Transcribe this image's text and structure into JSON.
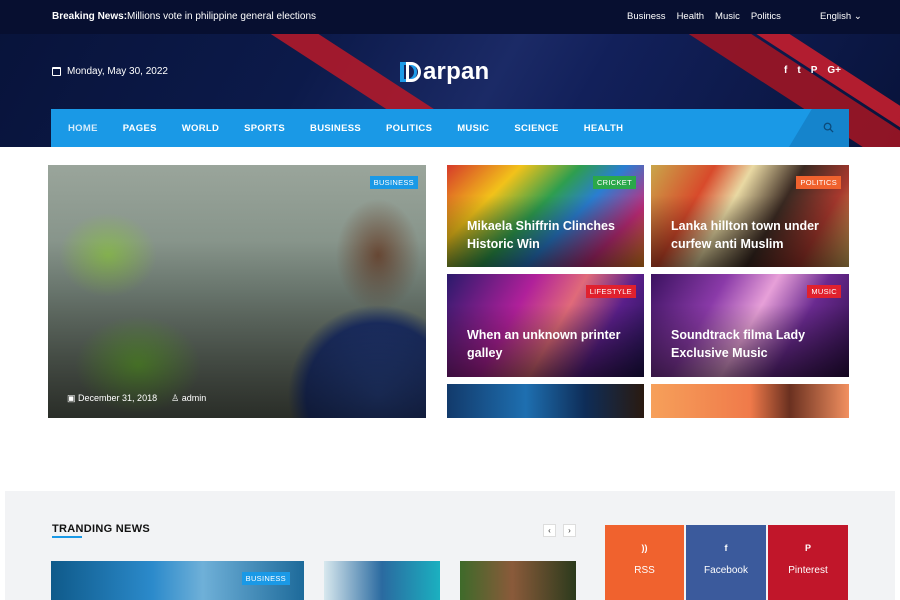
{
  "topbar": {
    "breaking_label": "Breaking News:",
    "breaking_text": "Millions vote in philippine general elections",
    "links": [
      "Business",
      "Health",
      "Music",
      "Politics"
    ],
    "language": "English"
  },
  "header": {
    "date": "Monday, May 30, 2022",
    "logo_text": "arpan",
    "socials": [
      "f",
      "t",
      "P",
      "G+"
    ]
  },
  "nav": {
    "items": [
      "HOME",
      "PAGES",
      "WORLD",
      "SPORTS",
      "BUSINESS",
      "POLITICS",
      "MUSIC",
      "SCIENCE",
      "HEALTH"
    ]
  },
  "featured": {
    "main": {
      "badge": "BUSINESS",
      "date": "December 31, 2018",
      "author": "admin"
    },
    "cards": [
      {
        "badge": "CRICKET",
        "title": "Mikaela Shiffrin Clinches Historic Win",
        "badge_color": "#2aa84a"
      },
      {
        "badge": "POLITICS",
        "title": "Lanka hillton town under curfew anti Muslim",
        "badge_color": "#f0622e"
      },
      {
        "badge": "LIFESTYLE",
        "title": "When an unknown printer galley",
        "badge_color": "#e0212e"
      },
      {
        "badge": "MUSIC",
        "title": "Soundtrack filma Lady Exclusive Music",
        "badge_color": "#e0212e"
      }
    ]
  },
  "trending": {
    "title": "TRANDING NEWS",
    "prev": "‹",
    "next": "›",
    "first_badge": "BUSINESS"
  },
  "social_tiles": {
    "rss": {
      "icon": "))",
      "label": "RSS"
    },
    "facebook": {
      "icon": "f",
      "label": "Facebook"
    },
    "pinterest": {
      "icon": "P",
      "label": "Pinterest"
    }
  },
  "colors": {
    "accent": "#1a99e6",
    "header_dark": "#070f30"
  }
}
